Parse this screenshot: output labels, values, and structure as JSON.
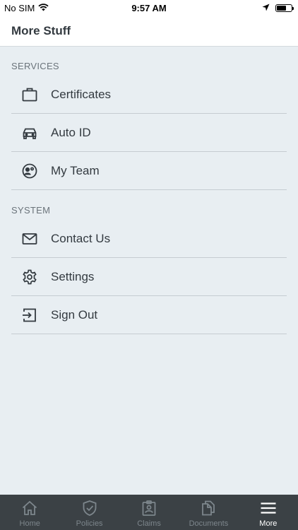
{
  "status_bar": {
    "carrier": "No SIM",
    "time": "9:57 AM",
    "battery_level": 0.65
  },
  "header": {
    "title": "More Stuff"
  },
  "sections": [
    {
      "title": "SERVICES",
      "items": [
        {
          "label": "Certificates",
          "icon": "briefcase-icon"
        },
        {
          "label": "Auto ID",
          "icon": "car-icon"
        },
        {
          "label": "My Team",
          "icon": "team-icon"
        }
      ]
    },
    {
      "title": "SYSTEM",
      "items": [
        {
          "label": "Contact Us",
          "icon": "mail-icon"
        },
        {
          "label": "Settings",
          "icon": "gear-icon"
        },
        {
          "label": "Sign Out",
          "icon": "sign-out-icon"
        }
      ]
    }
  ],
  "tabs": [
    {
      "label": "Home",
      "icon": "home-icon",
      "active": false
    },
    {
      "label": "Policies",
      "icon": "shield-icon",
      "active": false
    },
    {
      "label": "Claims",
      "icon": "clipboard-icon",
      "active": false
    },
    {
      "label": "Documents",
      "icon": "documents-icon",
      "active": false
    },
    {
      "label": "More",
      "icon": "hamburger-icon",
      "active": true
    }
  ],
  "colors": {
    "background": "#e8eef2",
    "tab_bar": "#3b4145",
    "tab_inactive": "#7d868c",
    "tab_active": "#ffffff",
    "text": "#333a40"
  }
}
